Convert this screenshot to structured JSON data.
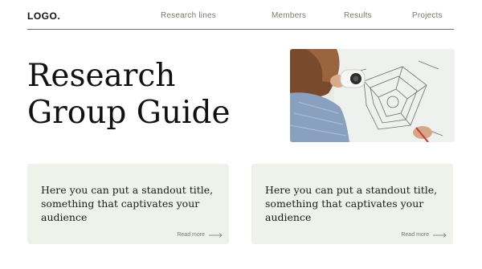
{
  "header": {
    "logo": "LOGO.",
    "nav": [
      "Research lines",
      "Members",
      "Results",
      "Projects"
    ]
  },
  "hero": {
    "title_line1": "Research",
    "title_line2": "Group Guide",
    "image_alt": "Person examining a technical drawing with a magnifier"
  },
  "cards": [
    {
      "title": "Here you can put a standout title, something that captivates your audience",
      "link": "Read more"
    },
    {
      "title": "Here you can put a standout title, something that captivates your audience",
      "link": "Read more"
    }
  ],
  "colors": {
    "card_background": "#eef2ea",
    "nav_text": "#7a7a6e",
    "rule": "#6f6f6f"
  }
}
